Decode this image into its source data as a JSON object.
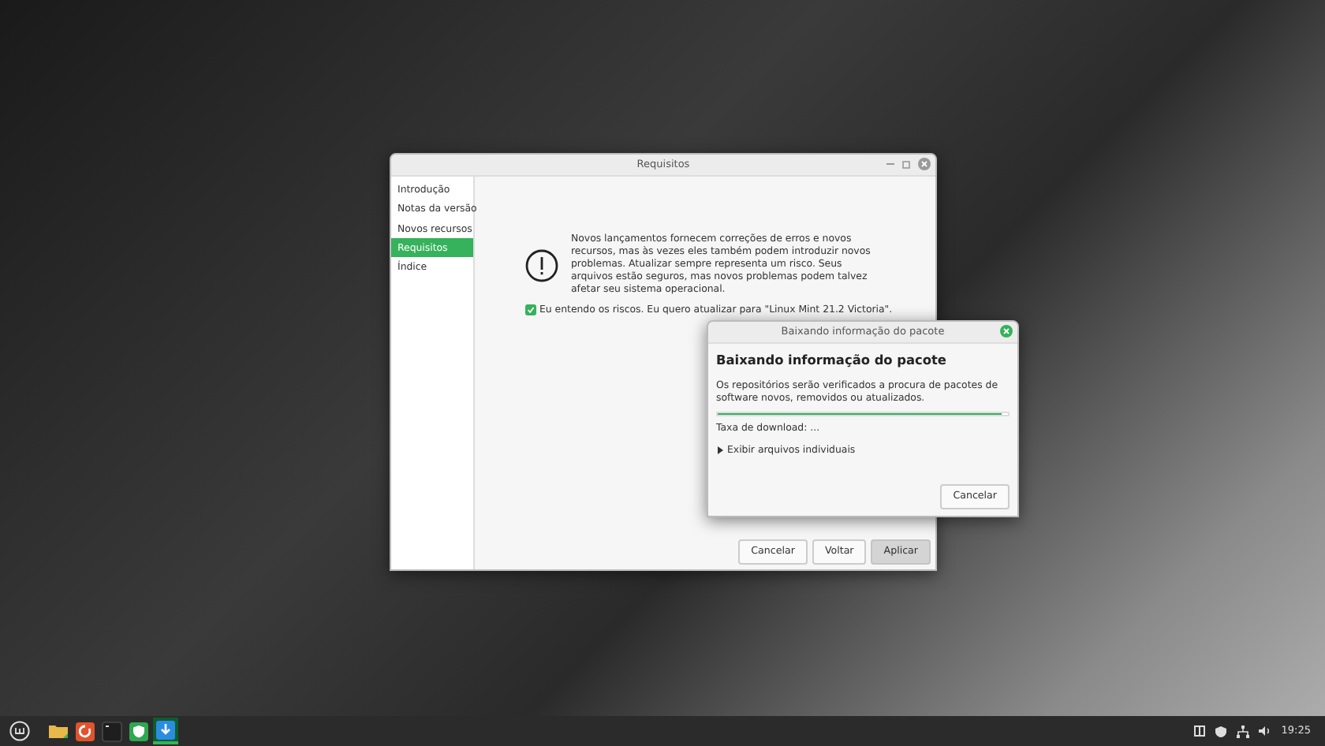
{
  "main_window": {
    "title": "Requisitos",
    "sidebar": [
      {
        "label": "Introdução",
        "selected": false
      },
      {
        "label": "Notas da versão",
        "selected": false
      },
      {
        "label": "Novos recursos",
        "selected": false
      },
      {
        "label": "Requisitos",
        "selected": true
      },
      {
        "label": "Índice",
        "selected": false
      }
    ],
    "message": "Novos lançamentos fornecem correções de erros e novos recursos, mas às vezes eles também podem introduzir novos problemas. Atualizar sempre representa um risco. Seus arquivos estão seguros, mas novos problemas podem talvez afetar seu sistema operacional.",
    "agree": {
      "label": "Eu entendo os riscos. Eu quero atualizar para \"Linux Mint 21.2 Victoria\".",
      "checked": true
    },
    "buttons": [
      {
        "label": "Cancelar",
        "kind": "normal"
      },
      {
        "label": "Voltar",
        "kind": "normal"
      },
      {
        "label": "Aplicar",
        "kind": "pressed"
      }
    ]
  },
  "dialog": {
    "title": "Baixando informação do pacote",
    "heading": "Baixando informação do pacote",
    "description": "Os repositórios serão verificados a procura de pacotes de software novos, removidos ou atualizados.",
    "progress": {
      "level": 0.98
    },
    "status": "Taxa de download: ...",
    "expander": {
      "label": "Exibir arquivos individuais",
      "expanded": false
    },
    "buttons": [
      {
        "label": "Cancelar"
      }
    ]
  },
  "taskbar": {
    "launchers": [
      {
        "kind": "files",
        "active": false
      },
      {
        "kind": "browser",
        "active": false
      },
      {
        "kind": "terminal",
        "active": false
      },
      {
        "kind": "shield",
        "active": false
      },
      {
        "kind": "download",
        "active": true
      }
    ],
    "clock": "19:25"
  }
}
